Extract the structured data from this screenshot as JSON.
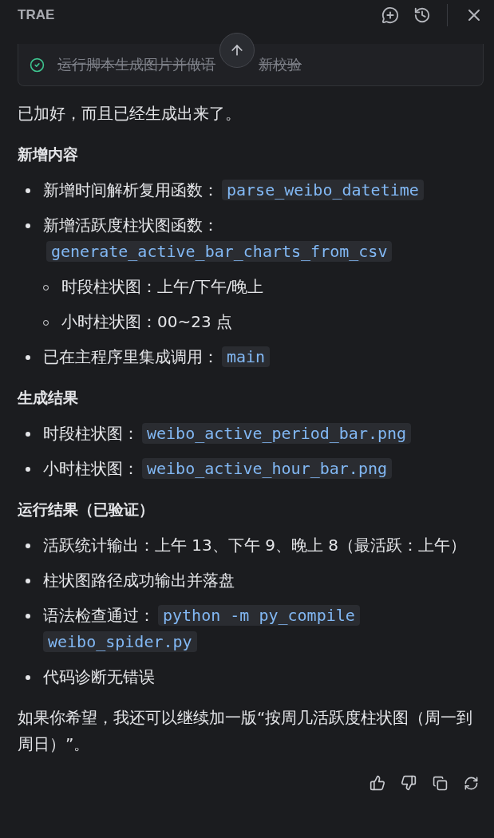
{
  "header": {
    "title": "TRAE"
  },
  "task": {
    "done": true,
    "text_before": "运行脚本生成图片并做语",
    "text_after": "新校验"
  },
  "blocks": [
    {
      "kind": "paragraph",
      "text": "已加好，而且已经生成出来了。"
    },
    {
      "kind": "heading",
      "text": "新增内容"
    },
    {
      "kind": "list",
      "items": [
        {
          "text": "新增时间解析复用函数：",
          "code": "parse_weibo_datetime"
        },
        {
          "text": "新增活跃度柱状图函数：",
          "code": "generate_active_bar_charts_from_csv",
          "children": [
            {
              "text": "时段柱状图：上午/下午/晚上"
            },
            {
              "text": "小时柱状图：00~23 点"
            }
          ]
        },
        {
          "text": "已在主程序里集成调用：",
          "code": "main"
        }
      ]
    },
    {
      "kind": "heading",
      "text": "生成结果"
    },
    {
      "kind": "list",
      "items": [
        {
          "text": "时段柱状图：",
          "code": "weibo_active_period_bar.png"
        },
        {
          "text": "小时柱状图：",
          "code": "weibo_active_hour_bar.png"
        }
      ]
    },
    {
      "kind": "heading",
      "text": "运行结果（已验证）"
    },
    {
      "kind": "list",
      "items": [
        {
          "text": "活跃统计输出：上午 13、下午 9、晚上 8（最活跃：上午）"
        },
        {
          "text": "柱状图路径成功输出并落盘"
        },
        {
          "text": "语法检查通过：",
          "code_lines": [
            "python -m py_compile",
            "weibo_spider.py"
          ]
        },
        {
          "text": "代码诊断无错误"
        }
      ]
    },
    {
      "kind": "paragraph",
      "text": "如果你希望，我还可以继续加一版“按周几活跃度柱状图（周一到周日）”。"
    }
  ]
}
